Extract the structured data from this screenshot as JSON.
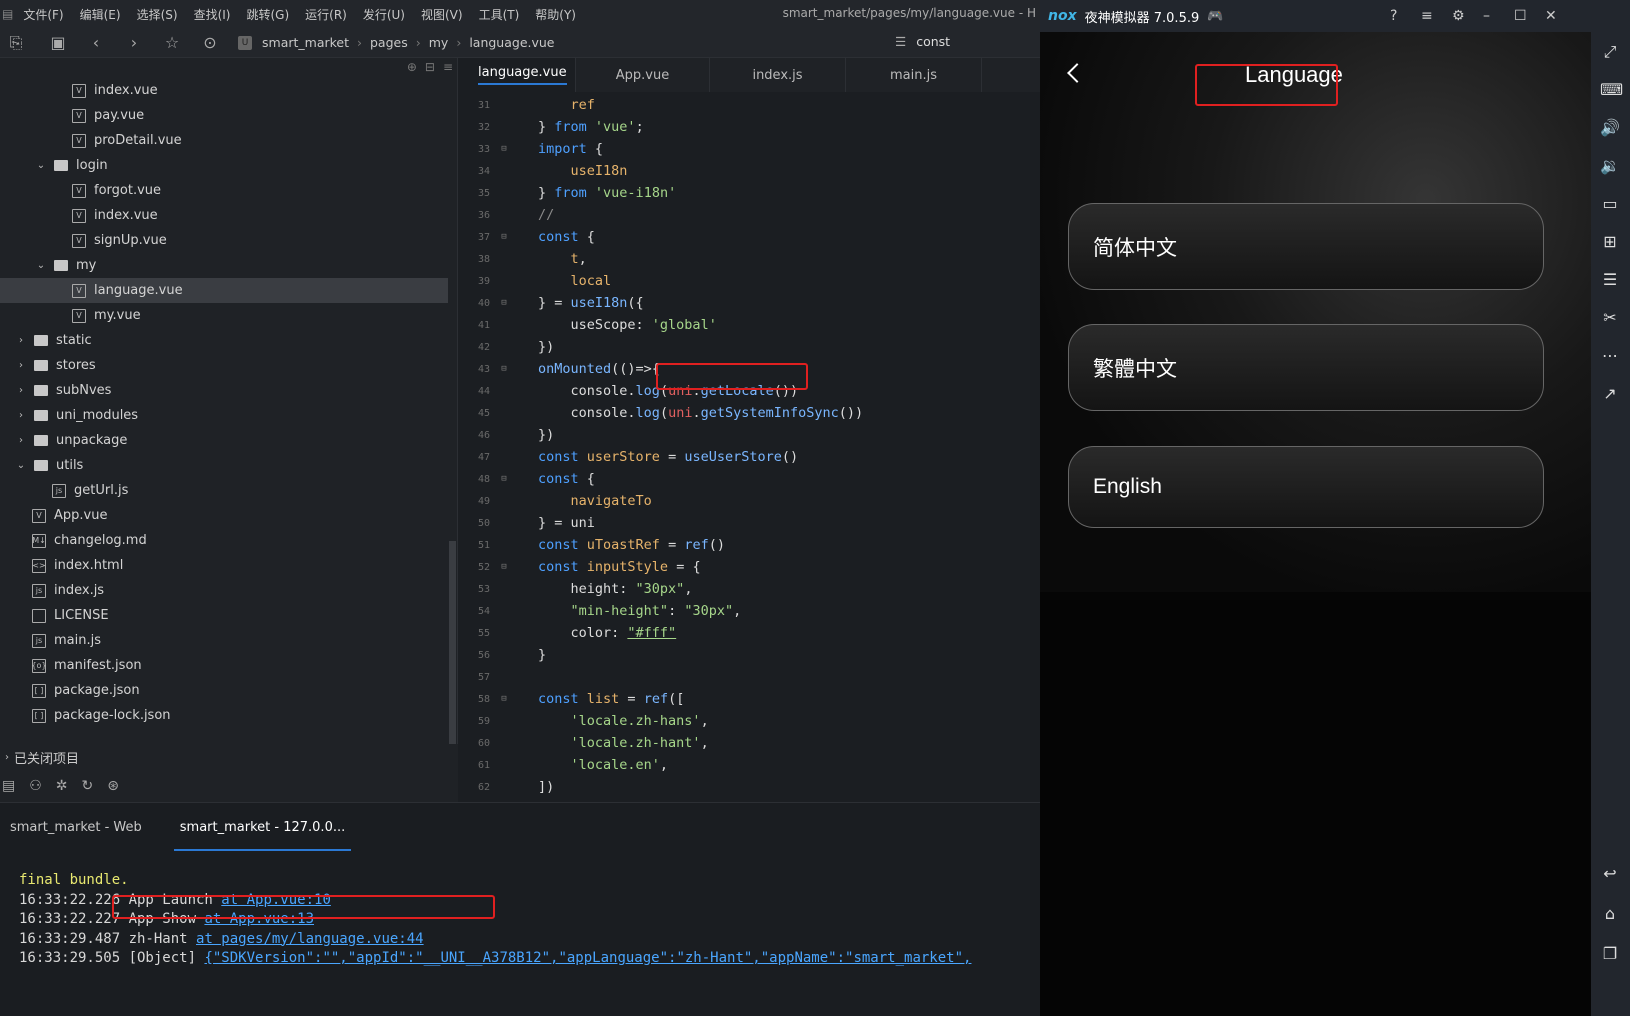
{
  "menu": [
    "文件(F)",
    "编辑(E)",
    "选择(S)",
    "查找(I)",
    "跳转(G)",
    "运行(R)",
    "发行(U)",
    "视图(V)",
    "工具(T)",
    "帮助(Y)"
  ],
  "window_title": "smart_market/pages/my/language.vue - H",
  "breadcrumb": [
    "smart_market",
    "pages",
    "my",
    "language.vue"
  ],
  "search_value": "const",
  "file_tree": [
    {
      "label": "index.vue",
      "depth": 3,
      "type": "file",
      "icon": "V"
    },
    {
      "label": "pay.vue",
      "depth": 3,
      "type": "file",
      "icon": "V"
    },
    {
      "label": "proDetail.vue",
      "depth": 3,
      "type": "file",
      "icon": "V"
    },
    {
      "label": "login",
      "depth": 2,
      "type": "folder",
      "open": true
    },
    {
      "label": "forgot.vue",
      "depth": 3,
      "type": "file",
      "icon": "V"
    },
    {
      "label": "index.vue",
      "depth": 3,
      "type": "file",
      "icon": "V"
    },
    {
      "label": "signUp.vue",
      "depth": 3,
      "type": "file",
      "icon": "V"
    },
    {
      "label": "my",
      "depth": 2,
      "type": "folder",
      "open": true
    },
    {
      "label": "language.vue",
      "depth": 3,
      "type": "file",
      "icon": "V",
      "selected": true
    },
    {
      "label": "my.vue",
      "depth": 3,
      "type": "file",
      "icon": "V"
    },
    {
      "label": "static",
      "depth": 1,
      "type": "folder",
      "open": false
    },
    {
      "label": "stores",
      "depth": 1,
      "type": "folder",
      "open": false
    },
    {
      "label": "subNves",
      "depth": 1,
      "type": "folder",
      "open": false
    },
    {
      "label": "uni_modules",
      "depth": 1,
      "type": "folder",
      "open": false
    },
    {
      "label": "unpackage",
      "depth": 1,
      "type": "folder",
      "open": false
    },
    {
      "label": "utils",
      "depth": 1,
      "type": "folder",
      "open": true
    },
    {
      "label": "getUrl.js",
      "depth": 2,
      "type": "file",
      "icon": "js"
    },
    {
      "label": "App.vue",
      "depth": 1,
      "type": "file",
      "icon": "V"
    },
    {
      "label": "changelog.md",
      "depth": 1,
      "type": "file",
      "icon": "M↓"
    },
    {
      "label": "index.html",
      "depth": 1,
      "type": "file",
      "icon": "<>"
    },
    {
      "label": "index.js",
      "depth": 1,
      "type": "file",
      "icon": "js"
    },
    {
      "label": "LICENSE",
      "depth": 1,
      "type": "file",
      "icon": ""
    },
    {
      "label": "main.js",
      "depth": 1,
      "type": "file",
      "icon": "js"
    },
    {
      "label": "manifest.json",
      "depth": 1,
      "type": "file",
      "icon": "{o}"
    },
    {
      "label": "package.json",
      "depth": 1,
      "type": "file",
      "icon": "[ ]"
    },
    {
      "label": "package-lock.json",
      "depth": 1,
      "type": "file",
      "icon": "[ ]"
    }
  ],
  "closed_projects": "已关闭项目",
  "editor_tabs": [
    "language.vue",
    "App.vue",
    "index.js",
    "main.js"
  ],
  "code_lines": [
    {
      "n": "31",
      "fold": false,
      "html": "    <span class=\"var\">ref</span>"
    },
    {
      "n": "32",
      "fold": false,
      "html": "} <span class=\"kw\">from</span> <span class=\"str\">'vue'</span>;"
    },
    {
      "n": "33",
      "fold": true,
      "html": "<span class=\"kw\">import</span> {"
    },
    {
      "n": "34",
      "fold": false,
      "html": "    <span class=\"var\">useI18n</span>"
    },
    {
      "n": "35",
      "fold": false,
      "html": "} <span class=\"kw\">from</span> <span class=\"str\">'vue-i18n'</span>"
    },
    {
      "n": "36",
      "fold": false,
      "html": "<span class=\"gray\">//</span>"
    },
    {
      "n": "37",
      "fold": true,
      "html": "<span class=\"kw\">const</span> {"
    },
    {
      "n": "38",
      "fold": false,
      "html": "    <span class=\"var\">t</span>,"
    },
    {
      "n": "39",
      "fold": false,
      "html": "    <span class=\"var\">local</span>"
    },
    {
      "n": "40",
      "fold": true,
      "html": "} = <span class=\"fn\">useI18n</span>({"
    },
    {
      "n": "41",
      "fold": false,
      "html": "    useScope: <span class=\"str\">'global'</span>"
    },
    {
      "n": "42",
      "fold": false,
      "html": "})"
    },
    {
      "n": "43",
      "fold": true,
      "html": "<span class=\"fn\">onMounted</span>(()=>{"
    },
    {
      "n": "44",
      "fold": false,
      "html": "    console.<span class=\"fn\">log</span>(<span class=\"red\">uni</span>.<span class=\"fn\">getLocale</span>())"
    },
    {
      "n": "45",
      "fold": false,
      "html": "    console.<span class=\"fn\">log</span>(<span class=\"red\">uni</span>.<span class=\"fn\">getSystemInfoSync</span>())"
    },
    {
      "n": "46",
      "fold": false,
      "html": "})"
    },
    {
      "n": "47",
      "fold": false,
      "html": "<span class=\"kw\">const</span> <span class=\"var\">userStore</span> = <span class=\"fn\">useUserStore</span>()"
    },
    {
      "n": "48",
      "fold": true,
      "html": "<span class=\"kw\">const</span> {"
    },
    {
      "n": "49",
      "fold": false,
      "html": "    <span class=\"var\">navigateTo</span>"
    },
    {
      "n": "50",
      "fold": false,
      "html": "} = uni"
    },
    {
      "n": "51",
      "fold": false,
      "html": "<span class=\"kw\">const</span> <span class=\"var\">uToastRef</span> = <span class=\"fn\">ref</span>()"
    },
    {
      "n": "52",
      "fold": true,
      "html": "<span class=\"kw\">const</span> <span class=\"var\">inputStyle</span> = {"
    },
    {
      "n": "53",
      "fold": false,
      "html": "    height: <span class=\"str\">\"30px\"</span>,"
    },
    {
      "n": "54",
      "fold": false,
      "html": "    <span class=\"str\">\"min-height\"</span>: <span class=\"str\">\"30px\"</span>,"
    },
    {
      "n": "55",
      "fold": false,
      "html": "    color: <span class=\"str\" style=\"text-decoration:underline\">\"#fff\"</span>"
    },
    {
      "n": "56",
      "fold": false,
      "html": "}"
    },
    {
      "n": "57",
      "fold": false,
      "html": ""
    },
    {
      "n": "58",
      "fold": true,
      "html": "<span class=\"kw\">const</span> <span class=\"var\">list</span> = <span class=\"fn\">ref</span>(["
    },
    {
      "n": "59",
      "fold": false,
      "html": "    <span class=\"str\">'locale.zh-hans'</span>,"
    },
    {
      "n": "60",
      "fold": false,
      "html": "    <span class=\"str\">'locale.zh-hant'</span>,"
    },
    {
      "n": "61",
      "fold": false,
      "html": "    <span class=\"str\">'locale.en'</span>,"
    },
    {
      "n": "62",
      "fold": false,
      "html": "])"
    }
  ],
  "console_tabs": [
    "smart_market - Web",
    "smart_market - 127.0.0..."
  ],
  "console_lines": [
    {
      "text": "final bundle.",
      "cls": "yellow",
      "link": ""
    },
    {
      "text": "16:33:22.226 App Launch ",
      "cls": "",
      "link": "at App.vue:10"
    },
    {
      "text": "16:33:22.227 App Show ",
      "cls": "",
      "link": "at App.vue:13"
    },
    {
      "text": "16:33:29.487 zh-Hant ",
      "cls": "",
      "link": "at pages/my/language.vue:44"
    },
    {
      "text": "16:33:29.505 [Object] ",
      "cls": "",
      "link": "{\"SDKVersion\":\"\",\"appId\":\"__UNI__A378B12\",\"appLanguage\":\"zh-Hant\",\"appName\":\"smart_market\","
    }
  ],
  "emulator": {
    "title": "夜神模拟器 7.0.5.9",
    "logo": "nox",
    "nav_title": "Language",
    "languages": [
      "简体中文",
      "繁體中文",
      "English"
    ]
  },
  "colors": {
    "accent": "#2b79d4",
    "highlight": "#e02020",
    "link": "#4aa6ff"
  }
}
